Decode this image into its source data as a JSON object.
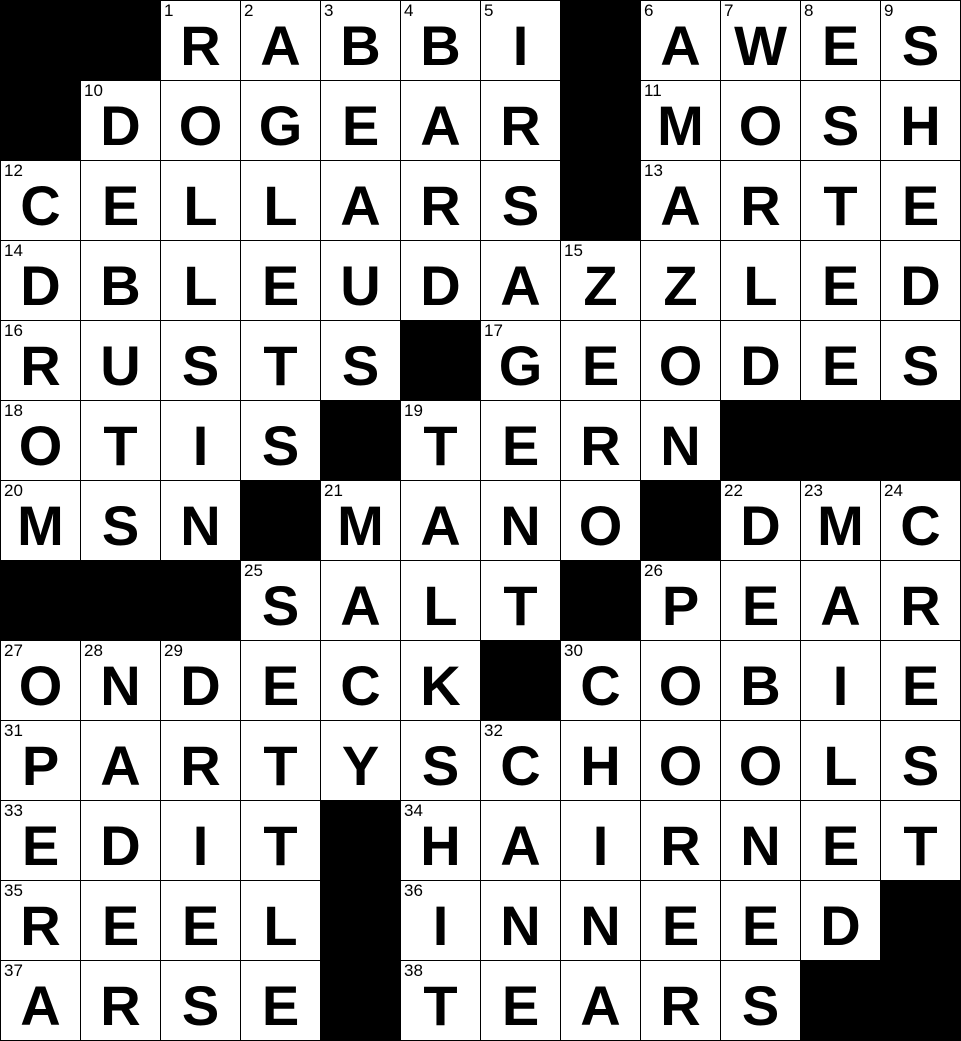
{
  "puzzle": {
    "rows": 13,
    "cols": 12,
    "grid": [
      "##RABBI#AWES",
      "#DOGEAR#MOSH",
      "CELLARS#ARTE",
      "DBLEUDAZZLED",
      "RUSTS#GEODES",
      "OTIS#TERN###",
      "MSN#MANO#DMC",
      "###SALT#PEAR",
      "ONDECK#COBIE",
      "PARTYSCHOOLS",
      "EDIT#HAIRNET",
      "REEL#INNEED#",
      "ARSE#TEARS##"
    ],
    "numbers": [
      {
        "r": 0,
        "c": 2,
        "n": "1"
      },
      {
        "r": 0,
        "c": 3,
        "n": "2"
      },
      {
        "r": 0,
        "c": 4,
        "n": "3"
      },
      {
        "r": 0,
        "c": 5,
        "n": "4"
      },
      {
        "r": 0,
        "c": 6,
        "n": "5"
      },
      {
        "r": 0,
        "c": 8,
        "n": "6"
      },
      {
        "r": 0,
        "c": 9,
        "n": "7"
      },
      {
        "r": 0,
        "c": 10,
        "n": "8"
      },
      {
        "r": 0,
        "c": 11,
        "n": "9"
      },
      {
        "r": 1,
        "c": 1,
        "n": "10"
      },
      {
        "r": 1,
        "c": 8,
        "n": "11"
      },
      {
        "r": 2,
        "c": 0,
        "n": "12"
      },
      {
        "r": 2,
        "c": 8,
        "n": "13"
      },
      {
        "r": 3,
        "c": 0,
        "n": "14"
      },
      {
        "r": 3,
        "c": 7,
        "n": "15"
      },
      {
        "r": 4,
        "c": 0,
        "n": "16"
      },
      {
        "r": 4,
        "c": 6,
        "n": "17"
      },
      {
        "r": 5,
        "c": 0,
        "n": "18"
      },
      {
        "r": 5,
        "c": 5,
        "n": "19"
      },
      {
        "r": 6,
        "c": 0,
        "n": "20"
      },
      {
        "r": 6,
        "c": 4,
        "n": "21"
      },
      {
        "r": 6,
        "c": 9,
        "n": "22"
      },
      {
        "r": 6,
        "c": 10,
        "n": "23"
      },
      {
        "r": 6,
        "c": 11,
        "n": "24"
      },
      {
        "r": 7,
        "c": 3,
        "n": "25"
      },
      {
        "r": 7,
        "c": 8,
        "n": "26"
      },
      {
        "r": 8,
        "c": 0,
        "n": "27"
      },
      {
        "r": 8,
        "c": 1,
        "n": "28"
      },
      {
        "r": 8,
        "c": 2,
        "n": "29"
      },
      {
        "r": 8,
        "c": 7,
        "n": "30"
      },
      {
        "r": 9,
        "c": 0,
        "n": "31"
      },
      {
        "r": 9,
        "c": 6,
        "n": "32"
      },
      {
        "r": 10,
        "c": 0,
        "n": "33"
      },
      {
        "r": 10,
        "c": 5,
        "n": "34"
      },
      {
        "r": 11,
        "c": 0,
        "n": "35"
      },
      {
        "r": 11,
        "c": 5,
        "n": "36"
      },
      {
        "r": 12,
        "c": 0,
        "n": "37"
      },
      {
        "r": 12,
        "c": 5,
        "n": "38"
      }
    ]
  }
}
